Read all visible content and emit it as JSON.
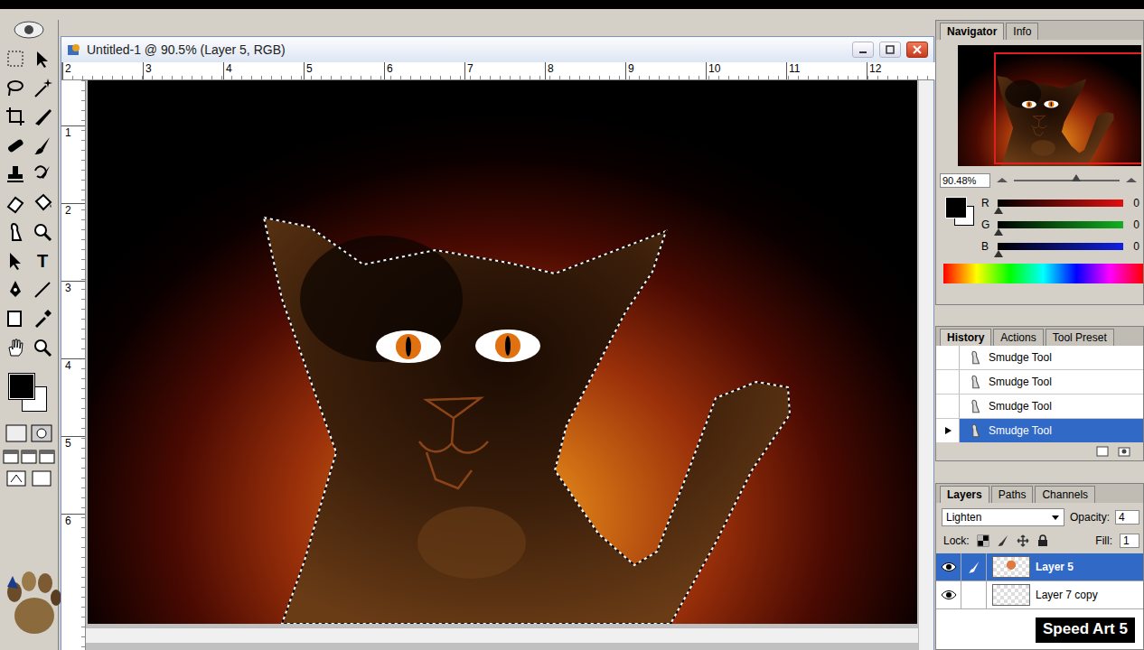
{
  "toolbox": {
    "type_tool": "T"
  },
  "document": {
    "title": "Untitled-1 @ 90.5% (Layer 5, RGB)",
    "ruler_h": [
      "2",
      "3",
      "4",
      "5",
      "6",
      "7",
      "8",
      "9",
      "10",
      "11",
      "12"
    ],
    "ruler_v": [
      "1",
      "2",
      "3",
      "4",
      "5",
      "6"
    ]
  },
  "navigator": {
    "tabs": [
      {
        "label": "Navigator",
        "selected": true
      },
      {
        "label": "Info",
        "selected": false
      }
    ],
    "zoom": "90.48%",
    "zoom_level": 0.55
  },
  "color": {
    "channels": [
      {
        "name": "R",
        "value": "0",
        "level": 0,
        "color": "#e01010"
      },
      {
        "name": "G",
        "value": "0",
        "level": 0,
        "color": "#10b020"
      },
      {
        "name": "B",
        "value": "0",
        "level": 0,
        "color": "#1020e0"
      }
    ]
  },
  "history": {
    "tabs": [
      {
        "label": "History",
        "selected": true
      },
      {
        "label": "Actions",
        "selected": false
      },
      {
        "label": "Tool Preset",
        "selected": false
      }
    ],
    "items": [
      {
        "label": "Smudge Tool",
        "selected": false
      },
      {
        "label": "Smudge Tool",
        "selected": false
      },
      {
        "label": "Smudge Tool",
        "selected": false
      },
      {
        "label": "Smudge Tool",
        "selected": true
      }
    ]
  },
  "layers": {
    "tabs": [
      {
        "label": "Layers",
        "selected": true
      },
      {
        "label": "Paths",
        "selected": false
      },
      {
        "label": "Channels",
        "selected": false
      }
    ],
    "blend_mode": "Lighten",
    "opacity_label": "Opacity:",
    "opacity": "4",
    "lock_label": "Lock:",
    "fill_label": "Fill:",
    "fill": "1",
    "items": [
      {
        "name": "Layer 5",
        "selected": true,
        "visible": true
      },
      {
        "name": "Layer 7 copy",
        "selected": false,
        "visible": true
      }
    ]
  },
  "watermark": "Speed Art 5"
}
